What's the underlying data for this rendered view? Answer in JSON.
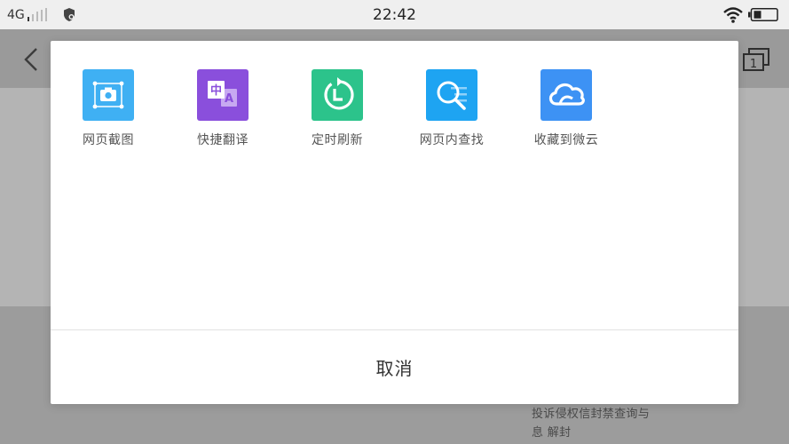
{
  "status_bar": {
    "network": "4G",
    "time": "22:42",
    "icons": [
      "signal-icon",
      "shield-icon",
      "wifi-icon",
      "battery-icon"
    ]
  },
  "background": {
    "icons": [
      "back-arrow-icon",
      "tabs-icon"
    ],
    "tab_count": "1",
    "footer_text": "投诉侵权信封禁查询与息 解封"
  },
  "dialog": {
    "actions": [
      {
        "label": "网页截图",
        "icon": "screenshot-icon",
        "color": "#3fb0f3"
      },
      {
        "label": "快捷翻译",
        "icon": "translate-icon",
        "color": "#8a4fdc"
      },
      {
        "label": "定时刷新",
        "icon": "timer-refresh-icon",
        "color": "#2cc38b"
      },
      {
        "label": "网页内查找",
        "icon": "find-in-page-icon",
        "color": "#1ea4f2"
      },
      {
        "label": "收藏到微云",
        "icon": "cloud-icon",
        "color": "#3d92f4"
      }
    ],
    "translate_glyph_cn": "中",
    "translate_glyph_en": "A",
    "cancel_label": "取消"
  }
}
